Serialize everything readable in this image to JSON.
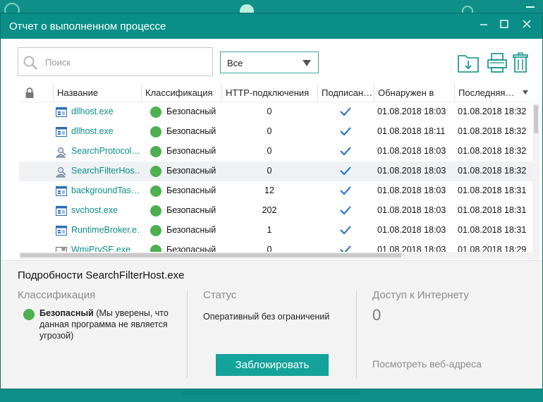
{
  "window": {
    "title": "Отчет о выполненном процессе",
    "minimize": "—",
    "maximize": "☐",
    "close": "✕"
  },
  "search": {
    "placeholder": "Поиск",
    "value": ""
  },
  "filter": {
    "selected": "Все"
  },
  "toolbar": {
    "icons": [
      "export-icon",
      "print-icon",
      "trash-icon"
    ]
  },
  "table": {
    "columns": [
      "",
      "Название",
      "Классификация",
      "HTTP-подключения",
      "Подписан…",
      "Обнаружен в",
      "Последняя…"
    ],
    "rows": [
      {
        "icon": "app-window-icon",
        "name": "dllhost.exe",
        "classification": "Безопасный",
        "http": "0",
        "signed": true,
        "detected": "01.08.2018 18:03",
        "last": "01.08.2018 18:32"
      },
      {
        "icon": "app-window-icon",
        "name": "dllhost.exe",
        "classification": "Безопасный",
        "http": "0",
        "signed": true,
        "detected": "01.08.2018 18:11",
        "last": "01.08.2018 18:32"
      },
      {
        "icon": "search-process-icon",
        "name": "SearchProtocol…",
        "classification": "Безопасный",
        "http": "0",
        "signed": true,
        "detected": "01.08.2018 18:03",
        "last": "01.08.2018 18:32"
      },
      {
        "icon": "search-process-icon",
        "name": "SearchFilterHos…",
        "classification": "Безопасный",
        "http": "0",
        "signed": true,
        "detected": "01.08.2018 18:03",
        "last": "01.08.2018 18:32"
      },
      {
        "icon": "app-window-icon",
        "name": "backgroundTas…",
        "classification": "Безопасный",
        "http": "12",
        "signed": true,
        "detected": "01.08.2018 18:03",
        "last": "01.08.2018 18:31"
      },
      {
        "icon": "app-window-icon",
        "name": "svchost.exe",
        "classification": "Безопасный",
        "http": "202",
        "signed": true,
        "detected": "01.08.2018 18:03",
        "last": "01.08.2018 18:31"
      },
      {
        "icon": "app-window-icon",
        "name": "RuntimeBroker.e…",
        "classification": "Безопасный",
        "http": "1",
        "signed": true,
        "detected": "01.08.2018 18:03",
        "last": "01.08.2018 18:31"
      },
      {
        "icon": "service-icon",
        "name": "WmiPrvSE.exe",
        "classification": "Безопасный",
        "http": "0",
        "signed": true,
        "detected": "01.08.2018 18:03",
        "last": "01.08.2018 18:29"
      }
    ],
    "selected_row": 3
  },
  "details": {
    "title": "Подробности SearchFilterHost.exe",
    "classification_header": "Классификация",
    "classification_bold": "Безопасный",
    "classification_note": " (Мы уверены, что данная программа не является угрозой)",
    "status_header": "Статус",
    "status_value": "Оперативный без ограничений",
    "internet_header": "Доступ к Интернету",
    "internet_value": "0",
    "block_button": "Заблокировать",
    "web_link": "Посмотреть веб-адреса"
  },
  "colors": {
    "accent": "#0a8e87",
    "safe": "#4caf50",
    "button": "#14a39a"
  }
}
